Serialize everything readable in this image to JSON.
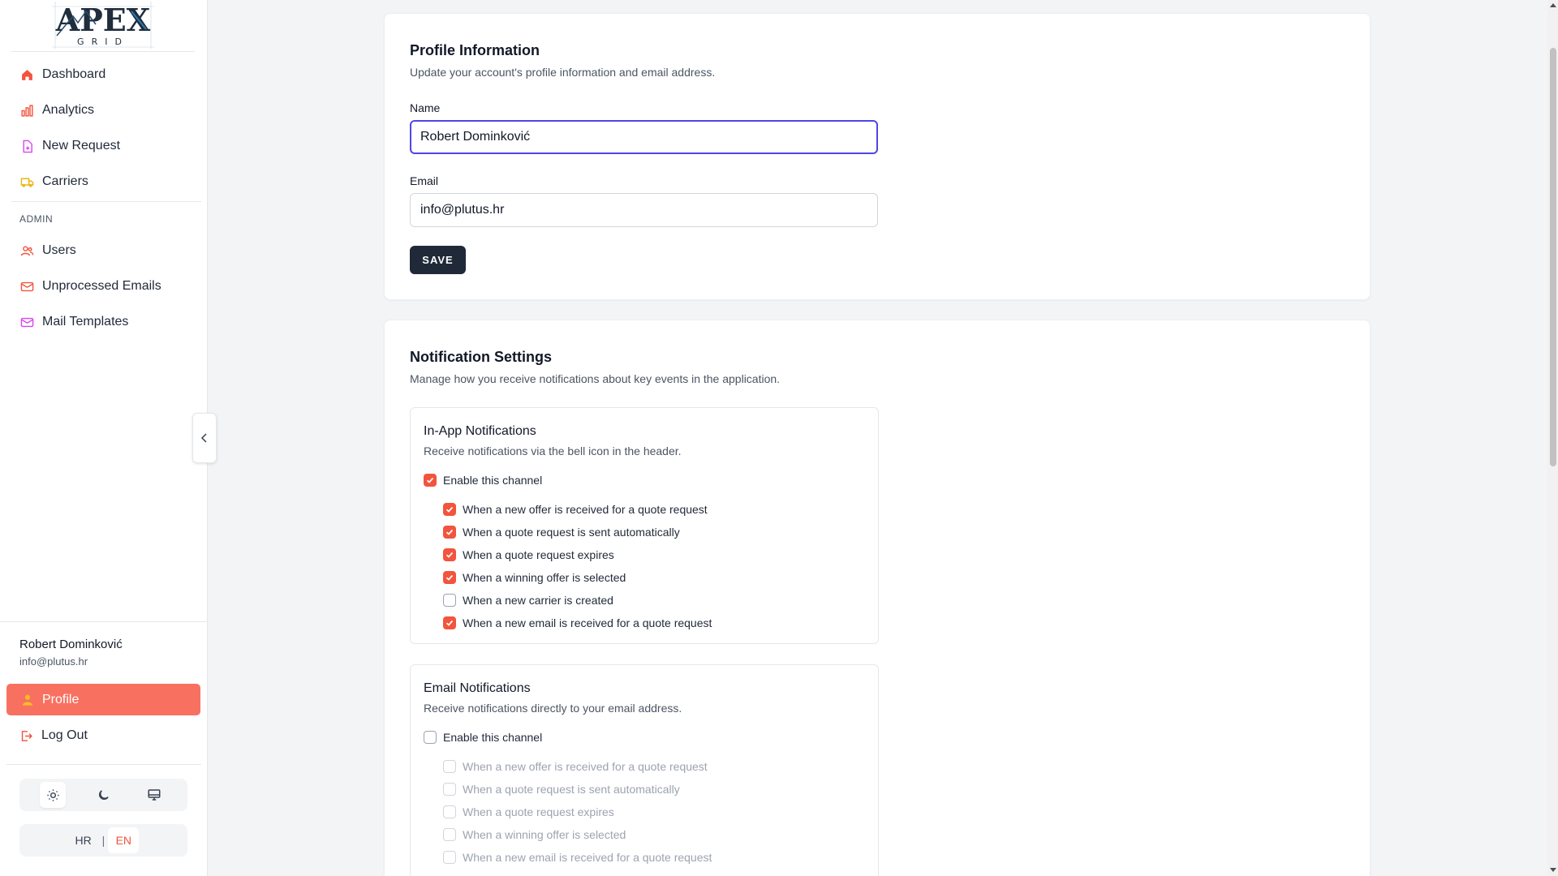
{
  "brand": {
    "logo_word": "APEX",
    "logo_sub": "GRID"
  },
  "sidebar": {
    "nav": [
      {
        "label": "Dashboard",
        "icon": "home-icon",
        "color": "#f2543d"
      },
      {
        "label": "Analytics",
        "icon": "bar-chart-icon",
        "color": "#f2543d"
      },
      {
        "label": "New Request",
        "icon": "file-plus-icon",
        "color": "#d946ef"
      },
      {
        "label": "Carriers",
        "icon": "truck-icon",
        "color": "#eab308"
      }
    ],
    "admin_title": "ADMIN",
    "admin": [
      {
        "label": "Users",
        "icon": "users-icon",
        "color": "#f2543d"
      },
      {
        "label": "Unprocessed Emails",
        "icon": "mail-icon",
        "color": "#f2543d"
      },
      {
        "label": "Mail Templates",
        "icon": "mail-template-icon",
        "color": "#d946ef"
      }
    ],
    "user": {
      "name": "Robert Dominković",
      "email": "info@plutus.hr"
    },
    "profile_label": "Profile",
    "logout_label": "Log Out",
    "theme": {
      "active": "light",
      "options": [
        "light",
        "dark",
        "system"
      ]
    },
    "languages": [
      "HR",
      "EN"
    ],
    "active_language": "EN"
  },
  "profile": {
    "title": "Profile Information",
    "description": "Update your account's profile information and email address.",
    "name_label": "Name",
    "name_value": "Robert Dominković",
    "email_label": "Email",
    "email_value": "info@plutus.hr",
    "save_label": "SAVE"
  },
  "notifications": {
    "title": "Notification Settings",
    "description": "Manage how you receive notifications about key events in the application.",
    "channels": [
      {
        "title": "In-App Notifications",
        "description": "Receive notifications via the bell icon in the header.",
        "enable_label": "Enable this channel",
        "enabled": true,
        "events": [
          {
            "label": "When a new offer is received for a quote request",
            "checked": true
          },
          {
            "label": "When a quote request is sent automatically",
            "checked": true
          },
          {
            "label": "When a quote request expires",
            "checked": true
          },
          {
            "label": "When a winning offer is selected",
            "checked": true
          },
          {
            "label": "When a new carrier is created",
            "checked": false
          },
          {
            "label": "When a new email is received for a quote request",
            "checked": true
          }
        ]
      },
      {
        "title": "Email Notifications",
        "description": "Receive notifications directly to your email address.",
        "enable_label": "Enable this channel",
        "enabled": false,
        "events": [
          {
            "label": "When a new offer is received for a quote request",
            "checked": false
          },
          {
            "label": "When a quote request is sent automatically",
            "checked": false
          },
          {
            "label": "When a quote request expires",
            "checked": false
          },
          {
            "label": "When a winning offer is selected",
            "checked": false
          },
          {
            "label": "When a new email is received for a quote request",
            "checked": false
          }
        ]
      }
    ]
  },
  "colors": {
    "accent": "#f2543d",
    "profile_active_bg": "#f87160",
    "focus_ring": "#4f46e5",
    "save_bg": "#1f2937"
  }
}
